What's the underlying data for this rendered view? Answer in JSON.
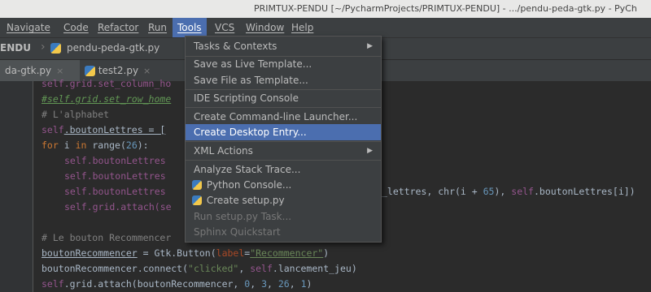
{
  "window": {
    "title": "PRIMTUX-PENDU [~/PycharmProjects/PRIMTUX-PENDU] - .../pendu-peda-gtk.py - PyCh"
  },
  "menubar": {
    "items": [
      "Navigate",
      "Code",
      "Refactor",
      "Run",
      "Tools",
      "VCS",
      "Window",
      "Help"
    ],
    "active": "Tools"
  },
  "navbar": {
    "project": "ENDU",
    "file": "pendu-peda-gtk.py"
  },
  "tabs": [
    {
      "label": "da-gtk.py",
      "close": "×",
      "active": true
    },
    {
      "label": "test2.py",
      "close": "×",
      "active": false
    }
  ],
  "tools_menu": {
    "items": [
      {
        "label": "Tasks & Contexts",
        "submenu": true
      },
      {
        "label": "Save as Live Template..."
      },
      {
        "label": "Save File as Template..."
      },
      {
        "label": "IDE Scripting Console"
      },
      {
        "label": "Create Command-line Launcher..."
      },
      {
        "label": "Create Desktop Entry...",
        "selected": true
      },
      {
        "label": "XML Actions",
        "submenu": true
      },
      {
        "label": "Analyze Stack Trace..."
      },
      {
        "label": "Python Console...",
        "icon": "python-icon"
      },
      {
        "label": "Create setup.py",
        "icon": "python-icon"
      },
      {
        "label": "Run setup.py Task...",
        "disabled": true
      },
      {
        "label": "Sphinx Quickstart",
        "disabled": true
      }
    ],
    "submenu_arrow": "▶"
  },
  "code": {
    "l1": "self.grid.set_column_ho",
    "l2": "#self.grid.set_row_home",
    "l3": "# L'alphabet",
    "l4a": "self",
    "l4b": ".boutonLettres = [",
    "l5a": "for",
    "l5b": " i ",
    "l5c": "in",
    "l5d": " range(",
    "l5e": "26",
    "l5f": "):",
    "l6": "self.boutonLettres",
    "l7": "self.boutonLettres",
    "l8a": "self.boutonLettres",
    "l8b": "_lettres, chr(i + ",
    "l8c": "65",
    "l8d": "), ",
    "l8e": "self",
    "l8f": ".boutonLettres[i])",
    "l9": "self.grid.attach(se",
    "l10": "# Le bouton Recommencer",
    "l11a": "boutonRecommencer",
    "l11b": " = Gtk.Button(",
    "l11c": "label",
    "l11d": "=",
    "l11e": "\"Recommencer\"",
    "l11f": ")",
    "l12a": "boutonRecommencer.connect(",
    "l12b": "\"clicked\"",
    "l12c": ", ",
    "l12d": "self",
    "l12e": ".lancement_jeu)",
    "l13a": "self",
    "l13b": ".grid.attach(boutonRecommencer, ",
    "l13c": "0",
    "l13d": ", ",
    "l13e": "3",
    "l13f": ", ",
    "l13g": "26",
    "l13h": ", ",
    "l13i": "1",
    "l13j": ")"
  }
}
